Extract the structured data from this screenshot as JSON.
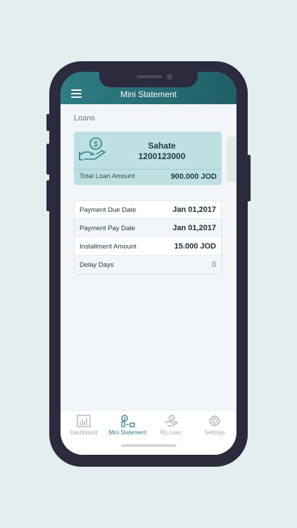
{
  "header": {
    "title": "Mini Statement"
  },
  "section": {
    "label": "Loans"
  },
  "loan": {
    "name": "Sahate",
    "number": "1200123000",
    "total_label": "Total Loan Amount",
    "total_value": "900.000 JOD"
  },
  "details": [
    {
      "label": "Payment Due Date",
      "value": "Jan 01,2017"
    },
    {
      "label": "Payment Pay Date",
      "value": "Jan 01,2017"
    },
    {
      "label": "Installment Amount",
      "value": "15.000 JOD"
    },
    {
      "label": "Delay Days",
      "value": "0"
    }
  ],
  "tabs": [
    {
      "label": "Dashboard",
      "icon": "dashboard-icon",
      "active": false
    },
    {
      "label": "Mini Statement",
      "icon": "mini-statement-icon",
      "active": true
    },
    {
      "label": "My Loan",
      "icon": "my-loan-icon",
      "active": false
    },
    {
      "label": "Settings",
      "icon": "settings-icon",
      "active": false
    }
  ],
  "colors": {
    "accent": "#2e7d84",
    "card": "#bfe0e2",
    "positive": "#33a63a",
    "frame": "#2b2b3d"
  }
}
